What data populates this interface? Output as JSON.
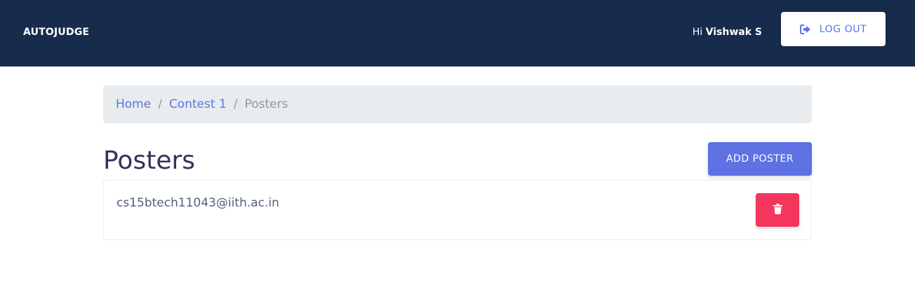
{
  "navbar": {
    "brand": "AUTOJUDGE",
    "greeting_prefix": "Hi ",
    "user_name": "Vishwak S",
    "logout_label": "LOG OUT",
    "logout_icon": "sign-out-icon"
  },
  "breadcrumb": {
    "items": [
      {
        "label": "Home"
      },
      {
        "label": "Contest 1"
      }
    ],
    "separator": "/",
    "active": "Posters"
  },
  "main": {
    "title": "Posters",
    "add_button_label": "ADD POSTER",
    "posters": [
      {
        "email": "cs15btech11043@iith.ac.in",
        "delete_icon": "trash-icon"
      }
    ]
  },
  "colors": {
    "navbar_bg": "#172b4d",
    "primary": "#5e72e4",
    "danger": "#f5365c",
    "breadcrumb_bg": "#e9ecef",
    "heading": "#32325d"
  }
}
